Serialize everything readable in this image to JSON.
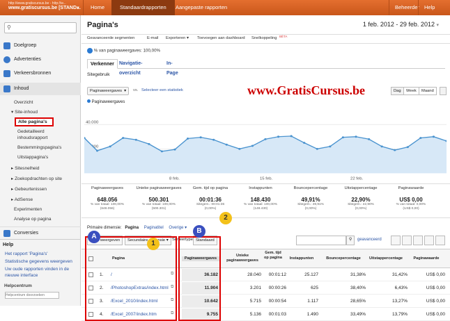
{
  "account": {
    "url": "http://www.gratiscursus.be - http://w...",
    "name": "www.gratiscursus.be [STAND..."
  },
  "topnav": {
    "home": "Home",
    "standard": "Standaardrapporten",
    "custom": "Aangepaste rapporten",
    "admin": "Beheerder",
    "help": "Help"
  },
  "sidebar": {
    "items": [
      {
        "label": "Doelgroep",
        "icon": "people-icon"
      },
      {
        "label": "Advertenties",
        "icon": "dollar-icon"
      },
      {
        "label": "Verkeersbronnen",
        "icon": "arrows-icon"
      },
      {
        "label": "Inhoud",
        "icon": "content-icon"
      }
    ],
    "inhoud_sub": [
      "Overzicht",
      "▾ Site-inhoud",
      "Alle pagina's",
      "Gedetailleerd",
      "inhoudsrapport",
      "Bestemmingspagina's",
      "Uitstappagina's",
      "▸ Sitesnelheid",
      "▸ Zoekopdrachten op site",
      "▸ Gebeurtenissen",
      "▸ AdSense",
      "Experimenten",
      "Analyse op pagina"
    ],
    "conversies": "Conversies",
    "help_title": "Help",
    "help_links": [
      "Het rapport 'Pagina's'",
      "Statistische gegevens weergeven",
      "Uw oude rapporten vinden in de",
      "nieuwe interface"
    ],
    "helpcentrum": "Helpcentrum",
    "help_search_placeholder": "Helpcentrum doorzoeken"
  },
  "main": {
    "title": "Pagina's",
    "date_range": "1 feb. 2012 - 29 feb. 2012",
    "toolbar": [
      "Geavanceerde segmenten",
      "E-mail",
      "Exporteren ▾",
      "Toevoegen aan dashboard",
      "Snelkoppeling"
    ],
    "beta": "BÈTA",
    "pct_line": "% van paginaweergaves: 100,00%",
    "tabs": [
      "Verkenner",
      "Navigatie-overzicht",
      "In-Page"
    ],
    "subtab": "Sitegebruik",
    "watermark": "www.GratisCursus.be",
    "metric_select": "Paginaweergaves",
    "compare_link": "Selecteer een statistiek",
    "segments": [
      "Dag",
      "Week",
      "Maand"
    ],
    "legend": "Paginaweergaves"
  },
  "chart_data": {
    "type": "area",
    "series": [
      {
        "name": "Paginaweergaves",
        "values": [
          29000,
          18500,
          22000,
          29000,
          27500,
          24000,
          18000,
          19500,
          28500,
          29500,
          27500,
          23500,
          20000,
          22500,
          28000,
          30000,
          30500,
          25000,
          20000,
          22000,
          29500,
          30000,
          28000,
          22000,
          19000,
          21500,
          29000,
          30000,
          26500
        ]
      }
    ],
    "x": [
      "1",
      "2",
      "3",
      "4",
      "5",
      "6",
      "7",
      "8",
      "9",
      "10",
      "11",
      "12",
      "13",
      "14",
      "15",
      "16",
      "17",
      "18",
      "19",
      "20",
      "21",
      "22",
      "23",
      "24",
      "25",
      "26",
      "27",
      "28",
      "29"
    ],
    "xticks": [
      "8 feb.",
      "15 feb.",
      "22 feb."
    ],
    "yticks": [
      "40.000",
      "20.000"
    ],
    "ylim": [
      0,
      40000
    ],
    "color": "#4a93cf"
  },
  "metrics": [
    {
      "label": "Paginaweergaves",
      "value": "648.056",
      "sub1": "% van totaal: 100,00%",
      "sub2": "(648.056)"
    },
    {
      "label": "Unieke paginaweergaves",
      "value": "500.301",
      "sub1": "% van totaal: 100,00%",
      "sub2": "(500.301)"
    },
    {
      "label": "Gem. tijd op pagina",
      "value": "00:01:36",
      "sub1": "Sitegem.: 00:01:36",
      "sub2": "(0,00%)"
    },
    {
      "label": "Instappunten",
      "value": "148.430",
      "sub1": "% van totaal: 100,00%",
      "sub2": "(148.430)"
    },
    {
      "label": "Bouncepercentage",
      "value": "49,91%",
      "sub1": "Sitegem.: 49,91%",
      "sub2": "(0,00%)"
    },
    {
      "label": "Uitstappercentage",
      "value": "22,90%",
      "sub1": "Sitegem.: 22,90%",
      "sub2": "(0,00%)"
    },
    {
      "label": "Paginawaarde",
      "value": "US$ 0,00",
      "sub1": "% van totaal: 0,00%",
      "sub2": "(US$ 0,00)"
    }
  ],
  "dimension": {
    "label": "Primaire dimensie:",
    "active": "Pagina",
    "alt": "Paginatitel",
    "other": "Overige ▾"
  },
  "table_tools": {
    "rows": "Rijen weergeven",
    "secondary": "Secundaire dimensie ▾",
    "sort": "Sorteertype:",
    "standard": "Standaard",
    "advanced": "geavanceerd"
  },
  "table": {
    "headers": [
      "Pagina",
      "Paginaweergaves",
      "Unieke paginaweergaves",
      "Gem. tijd op pagina",
      "Instappunten",
      "Bouncepercentage",
      "Uitstappercentage",
      "Paginawaarde"
    ],
    "rows": [
      {
        "n": "1.",
        "page": "/",
        "pv": "36.182",
        "upv": "28.040",
        "time": "00:01:12",
        "entr": "25.127",
        "bounce": "31,38%",
        "exit": "31,42%",
        "val": "US$ 0,00"
      },
      {
        "n": "2.",
        "page": "/PhotoshopExtras/index.html",
        "pv": "11.904",
        "upv": "3.201",
        "time": "00:00:26",
        "entr": "625",
        "bounce": "38,40%",
        "exit": "6,43%",
        "val": "US$ 0,00"
      },
      {
        "n": "3.",
        "page": "/Excel_2010/index.html",
        "pv": "10.642",
        "upv": "5.715",
        "time": "00:00:54",
        "entr": "1.117",
        "bounce": "28,65%",
        "exit": "13,27%",
        "val": "US$ 0,00"
      },
      {
        "n": "4.",
        "page": "/Excel_2007/index.htm",
        "pv": "9.755",
        "upv": "5.136",
        "time": "00:01:03",
        "entr": "1.490",
        "bounce": "33,49%",
        "exit": "13,79%",
        "val": "US$ 0,00"
      }
    ]
  },
  "callouts": {
    "a": "A",
    "b": "B",
    "one": "1",
    "two": "2"
  }
}
